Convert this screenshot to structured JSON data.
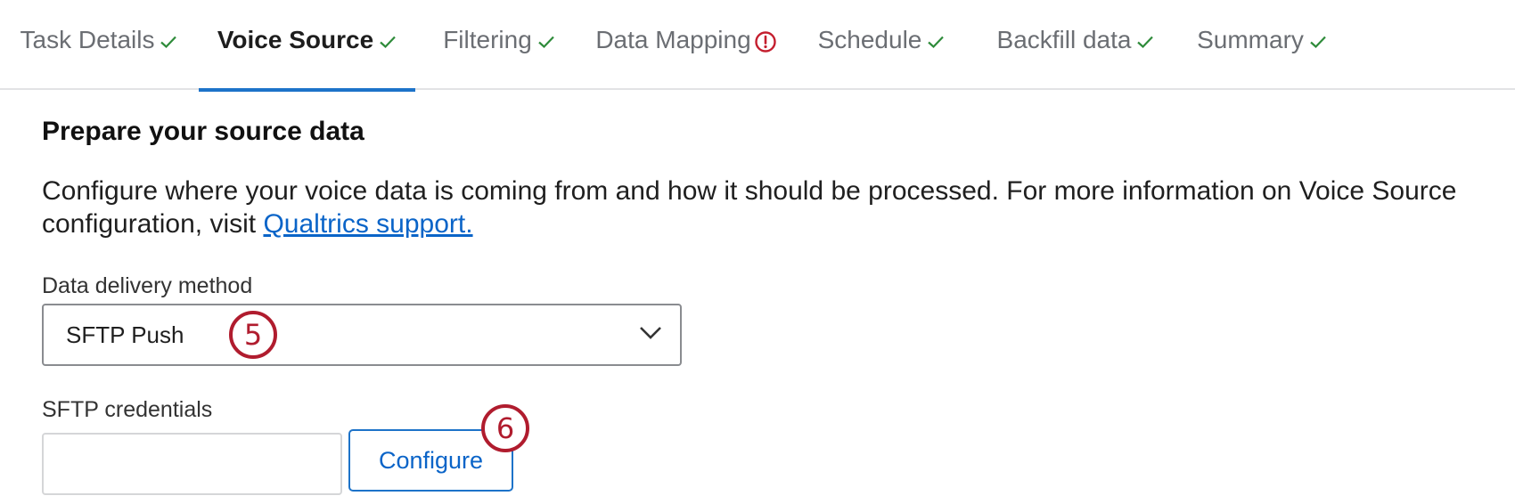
{
  "tabs": [
    {
      "label": "Task Details",
      "status": "complete",
      "status_icon": "check-icon",
      "active": false
    },
    {
      "label": "Voice Source",
      "status": "complete",
      "status_icon": "check-icon",
      "active": true
    },
    {
      "label": "Filtering",
      "status": "complete",
      "status_icon": "check-icon",
      "active": false
    },
    {
      "label": "Data Mapping",
      "status": "error",
      "status_icon": "alert-circle-icon",
      "active": false
    },
    {
      "label": "Schedule",
      "status": "complete",
      "status_icon": "check-icon",
      "active": false
    },
    {
      "label": "Backfill data",
      "status": "complete",
      "status_icon": "check-icon",
      "active": false
    },
    {
      "label": "Summary",
      "status": "complete",
      "status_icon": "check-icon",
      "active": false
    }
  ],
  "colors": {
    "accent": "#1d73c9",
    "check": "#2e8b3a",
    "error": "#c41e2e",
    "link": "#0a64c8",
    "marker": "#b01c2e"
  },
  "main": {
    "heading": "Prepare your source data",
    "description": "Configure where your voice data is coming from and how it should be processed. For more information on Voice Source configuration, visit ",
    "link_text": "Qualtrics support.",
    "delivery": {
      "label": "Data delivery method",
      "selected": "SFTP Push"
    },
    "credentials": {
      "label": "SFTP credentials",
      "value": "",
      "button_label": "Configure"
    }
  },
  "markers": {
    "step5": "5",
    "step6": "6"
  }
}
